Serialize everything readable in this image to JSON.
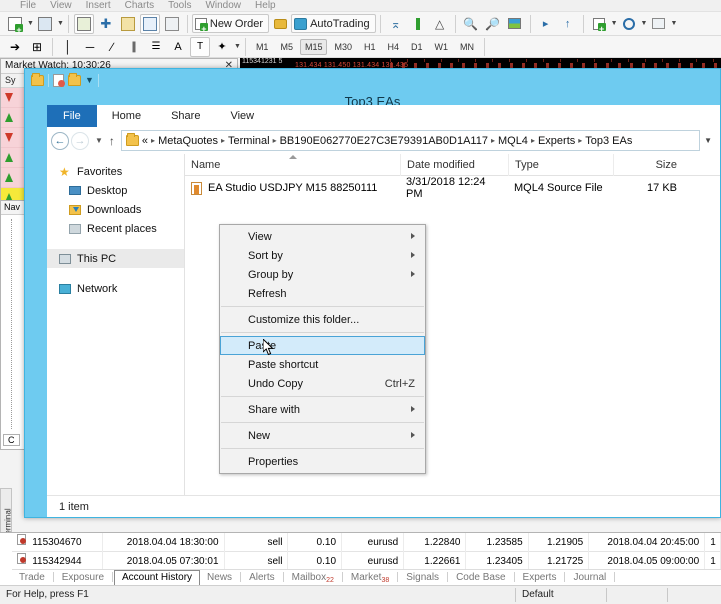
{
  "mt4": {
    "menu": [
      "File",
      "View",
      "Insert",
      "Charts",
      "Tools",
      "Window",
      "Help"
    ],
    "toolbar": {
      "new_order_label": "New Order",
      "autotrading_label": "AutoTrading",
      "icons": [
        "new-chart-icon",
        "save-chart-icon",
        "market-watch-icon",
        "data-window-icon",
        "navigator-icon",
        "terminal-icon",
        "strategy-tester-icon",
        "bar-chart-icon",
        "candlestick-chart-icon",
        "line-chart-icon",
        "zoom-in-icon",
        "zoom-out-icon",
        "tile-windows-icon",
        "auto-scroll-icon",
        "chart-shift-icon",
        "indicators-icon",
        "periods-icon",
        "templates-icon"
      ]
    },
    "periods": [
      "M1",
      "M5",
      "M15",
      "M30",
      "H1",
      "H4",
      "D1",
      "W1",
      "MN"
    ],
    "period_selected": "M15",
    "line_tools": [
      "cursor-icon",
      "crosshair-icon",
      "vertical-line-icon",
      "horizontal-line-icon",
      "trendline-icon",
      "equidistant-channel-icon",
      "fibonacci-retracement-icon",
      "text-icon",
      "text-label-icon",
      "shapes-icon"
    ],
    "market_watch": {
      "title": "Market Watch: 10:30:26",
      "column_header": "Sy",
      "tab_label": "Sy",
      "rows": [
        {
          "dir": "down"
        },
        {
          "dir": "up"
        },
        {
          "dir": "down"
        },
        {
          "dir": "up"
        },
        {
          "dir": "up"
        },
        {
          "dir": "up",
          "highlight": true
        },
        {
          "dir": "down"
        }
      ]
    },
    "navigator": {
      "title": "Nav",
      "bottom_tab": "C"
    },
    "chart_strip": {
      "label": "115341231 5",
      "prices": "131.434 131.450 131.434 131.435"
    },
    "terminal": {
      "vertical_label": "Terminal",
      "rows": [
        {
          "ticket": "115304670",
          "open_time": "2018.04.04 18:30:00",
          "type": "sell",
          "size": "0.10",
          "symbol": "eurusd",
          "price": "1.22840",
          "sl": "1.23585",
          "tp": "1.21905",
          "close_time": "2018.04.04 20:45:00",
          "trailing": "1"
        },
        {
          "ticket": "115342944",
          "open_time": "2018.04.05 07:30:01",
          "type": "sell",
          "size": "0.10",
          "symbol": "eurusd",
          "price": "1.22661",
          "sl": "1.23405",
          "tp": "1.21725",
          "close_time": "2018.04.05 09:00:00",
          "trailing": "1"
        }
      ],
      "tabs": [
        {
          "label": "Trade",
          "badge": ""
        },
        {
          "label": "Exposure",
          "badge": ""
        },
        {
          "label": "Account History",
          "badge": "",
          "active": true
        },
        {
          "label": "News",
          "badge": ""
        },
        {
          "label": "Alerts",
          "badge": ""
        },
        {
          "label": "Mailbox",
          "badge": "22"
        },
        {
          "label": "Market",
          "badge": "38"
        },
        {
          "label": "Signals",
          "badge": ""
        },
        {
          "label": "Code Base",
          "badge": ""
        },
        {
          "label": "Experts",
          "badge": ""
        },
        {
          "label": "Journal",
          "badge": ""
        }
      ]
    },
    "statusbar": {
      "help": "For Help, press F1",
      "profile": "Default"
    }
  },
  "explorer": {
    "window_title": "Top3 EAs",
    "quick_access": [
      "properties-icon",
      "new-folder-icon",
      "customize-qat-caret"
    ],
    "ribbon_tabs": [
      "File",
      "Home",
      "Share",
      "View"
    ],
    "nav_buttons": {
      "back": "back-arrow-icon",
      "forward": "forward-arrow-icon",
      "recent": "recent-locations-caret",
      "up": "up-arrow-icon"
    },
    "breadcrumb": [
      "«",
      "MetaQuotes",
      "Terminal",
      "BB190E062770E27C3E79391AB0D1A117",
      "MQL4",
      "Experts",
      "Top3 EAs"
    ],
    "nav_pane": [
      {
        "label": "Favorites",
        "icon": "star-icon",
        "indent": false
      },
      {
        "label": "Desktop",
        "icon": "desktop-icon",
        "indent": true
      },
      {
        "label": "Downloads",
        "icon": "downloads-icon",
        "indent": true
      },
      {
        "label": "Recent places",
        "icon": "recent-places-icon",
        "indent": true
      },
      {
        "label": "This PC",
        "icon": "this-pc-icon",
        "indent": false,
        "selected": true
      },
      {
        "label": "Network",
        "icon": "network-icon",
        "indent": false
      }
    ],
    "columns": [
      "Name",
      "Date modified",
      "Type",
      "Size"
    ],
    "files": [
      {
        "name": "EA Studio USDJPY M15 88250111",
        "date_modified": "3/31/2018 12:24 PM",
        "type": "MQL4 Source File",
        "size": "17 KB",
        "icon": "mq4-file-icon"
      }
    ],
    "status": "1 item"
  },
  "context_menu": {
    "items": [
      {
        "label": "View",
        "submenu": true
      },
      {
        "label": "Sort by",
        "submenu": true
      },
      {
        "label": "Group by",
        "submenu": true
      },
      {
        "label": "Refresh",
        "submenu": false
      },
      {
        "separator": true
      },
      {
        "label": "Customize this folder...",
        "submenu": false
      },
      {
        "separator": true
      },
      {
        "label": "Paste",
        "submenu": false,
        "selected": true
      },
      {
        "label": "Paste shortcut",
        "submenu": false
      },
      {
        "label": "Undo Copy",
        "submenu": false,
        "accel": "Ctrl+Z"
      },
      {
        "separator": true
      },
      {
        "label": "Share with",
        "submenu": true
      },
      {
        "separator": true
      },
      {
        "label": "New",
        "submenu": true
      },
      {
        "separator": true
      },
      {
        "label": "Properties",
        "submenu": false
      }
    ]
  },
  "colors": {
    "explorer_frame": "#6ecbf0",
    "ribbon_file": "#1e6fb8",
    "menu_highlight": "#d3ebfa",
    "menu_highlight_border": "#4aa3d6",
    "market_watch_bg": "#f7d3d8",
    "market_watch_highlight": "#f5e93a",
    "chart_price_text": "#e34b3a"
  }
}
